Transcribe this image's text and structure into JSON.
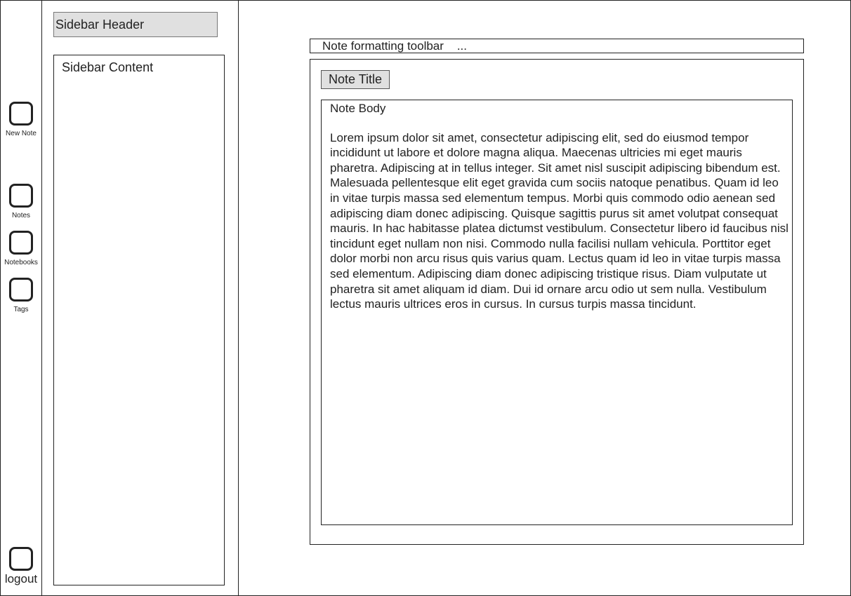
{
  "rail": {
    "items": [
      {
        "name": "new-note",
        "label": "New Note"
      },
      {
        "name": "notes",
        "label": "Notes"
      },
      {
        "name": "notebooks",
        "label": "Notebooks"
      },
      {
        "name": "tags",
        "label": "Tags"
      }
    ],
    "logout_label": "logout"
  },
  "sidebar": {
    "header": "Sidebar Header",
    "content_title": "Sidebar Content"
  },
  "editor": {
    "toolbar_label": "Note formatting toolbar    ...",
    "note_title": "Note Title",
    "body_heading": "Note Body",
    "body_text": "Lorem ipsum dolor sit amet, consectetur adipiscing elit, sed do eiusmod tempor incididunt ut labore et dolore magna aliqua. Maecenas ultricies mi eget mauris pharetra. Adipiscing at in tellus integer. Sit amet nisl suscipit adipiscing bibendum est. Malesuada pellentesque elit eget gravida cum sociis natoque penatibus. Quam id leo in vitae turpis massa sed elementum tempus. Morbi quis commodo odio aenean sed adipiscing diam donec adipiscing. Quisque sagittis purus sit amet volutpat consequat mauris. In hac habitasse platea dictumst vestibulum. Consectetur libero id faucibus nisl tincidunt eget nullam non nisi. Commodo nulla facilisi nullam vehicula. Porttitor eget dolor morbi non arcu risus quis varius quam. Lectus quam id leo in vitae turpis massa sed elementum. Adipiscing diam donec adipiscing tristique risus. Diam vulputate ut pharetra sit amet aliquam id diam. Dui id ornare arcu odio ut sem nulla. Vestibulum lectus mauris ultrices eros in cursus. In cursus turpis massa tincidunt."
  }
}
